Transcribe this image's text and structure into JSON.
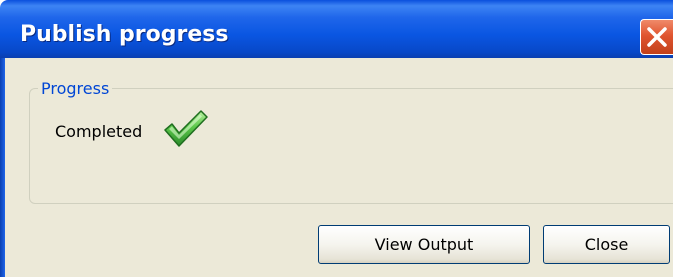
{
  "window": {
    "title": "Publish progress"
  },
  "progress_group": {
    "label": "Progress",
    "status": "Completed",
    "status_icon": "green-checkmark"
  },
  "buttons": {
    "view_output": "View Output",
    "close": "Close"
  },
  "colors": {
    "titlebar": "#0a56e2",
    "client_bg": "#ece9d8",
    "group_label": "#0046d5",
    "close_button": "#e05530",
    "check_green": "#3aa53a"
  }
}
